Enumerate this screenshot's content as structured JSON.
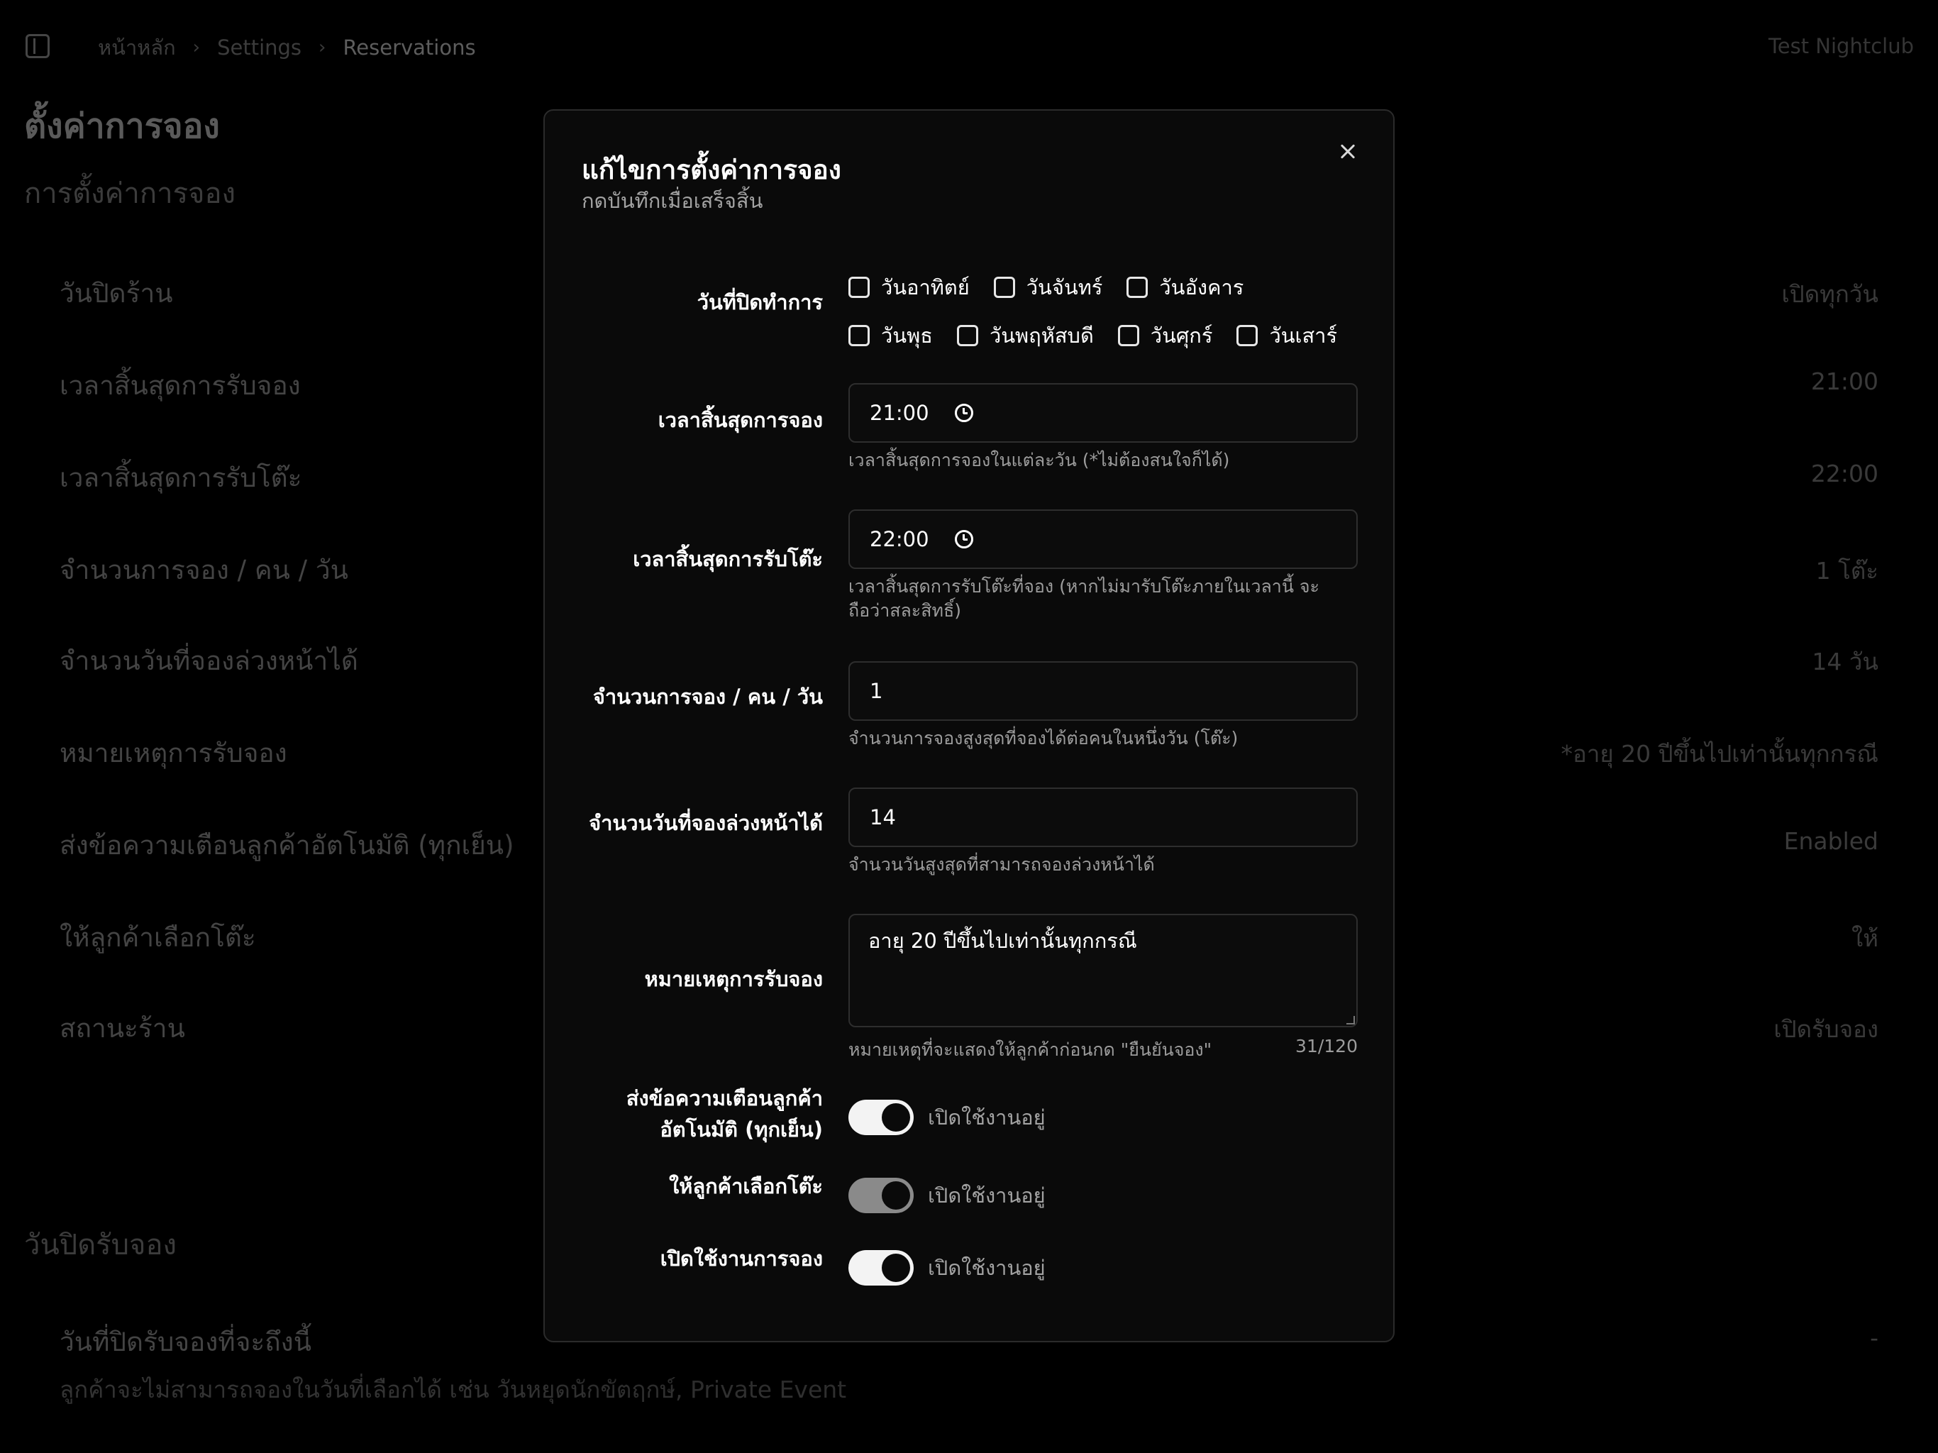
{
  "header": {
    "breadcrumb": [
      "หน้าหลัก",
      "Settings",
      "Reservations"
    ],
    "venue_name": "Test Nightclub"
  },
  "background": {
    "page_title": "ตั้งค่าการจอง",
    "section_title": "การตั้งค่าการจอง",
    "rows": [
      {
        "label": "วันปิดร้าน",
        "value": "เปิดทุกวัน"
      },
      {
        "label": "เวลาสิ้นสุดการรับจอง",
        "value": "21:00"
      },
      {
        "label": "เวลาสิ้นสุดการรับโต๊ะ",
        "value": "22:00"
      },
      {
        "label": "จำนวนการจอง / คน / วัน",
        "value": "1 โต๊ะ"
      },
      {
        "label": "จำนวนวันที่จองล่วงหน้าได้",
        "value": "14 วัน"
      },
      {
        "label": "หมายเหตุการรับจอง",
        "value": "*อายุ 20 ปีขึ้นไปเท่านั้นทุกกรณี"
      },
      {
        "label": "ส่งข้อความเตือนลูกค้าอัตโนมัติ (ทุกเย็น)",
        "value": "Enabled"
      },
      {
        "label": "ให้ลูกค้าเลือกโต๊ะ",
        "value": "ให้"
      },
      {
        "label": "สถานะร้าน",
        "value": "เปิดรับจอง"
      }
    ],
    "closure_section_title": "วันปิดรับจอง",
    "closure_row": {
      "label": "วันที่ปิดรับจองที่จะถึงนี้",
      "description": "ลูกค้าจะไม่สามารถจองในวันที่เลือกได้ เช่น วันหยุดนักขัตฤกษ์, Private Event",
      "value": "-"
    }
  },
  "modal": {
    "title": "แก้ไขการตั้งค่าการจอง",
    "subtitle": "กดบันทึกเมื่อเสร็จสิ้น",
    "closed_days": {
      "label": "วันที่ปิดทำการ",
      "days": [
        "วันอาทิตย์",
        "วันจันทร์",
        "วันอังคาร",
        "วันพุธ",
        "วันพฤหัสบดี",
        "วันศุกร์",
        "วันเสาร์"
      ]
    },
    "booking_end_time": {
      "label": "เวลาสิ้นสุดการจอง",
      "value": "21:00",
      "help": "เวลาสิ้นสุดการจองในแต่ละวัน (*ไม่ต้องสนใจก็ได้)"
    },
    "table_end_time": {
      "label": "เวลาสิ้นสุดการรับโต๊ะ",
      "value": "22:00",
      "help": "เวลาสิ้นสุดการรับโต๊ะที่จอง (หากไม่มารับโต๊ะภายในเวลานี้ จะถือว่าสละสิทธิ์)"
    },
    "bookings_per_day": {
      "label": "จำนวนการจอง / คน / วัน",
      "value": "1",
      "help": "จำนวนการจองสูงสุดที่จองได้ต่อคนในหนึ่งวัน (โต๊ะ)"
    },
    "advance_days": {
      "label": "จำนวนวันที่จองล่วงหน้าได้",
      "value": "14",
      "help": "จำนวนวันสูงสุดที่สามารถจองล่วงหน้าได้"
    },
    "booking_note": {
      "label": "หมายเหตุการรับจอง",
      "value": "อายุ 20 ปีขึ้นไปเท่านั้นทุกกรณี",
      "help": "หมายเหตุที่จะแสดงให้ลูกค้าก่อนกด \"ยืนยันจอง\"",
      "counter": "31/120"
    },
    "auto_reminder": {
      "label_line1": "ส่งข้อความเตือนลูกค้า",
      "label_line2": "อัตโนมัติ (ทุกเย็น)",
      "status": "เปิดใช้งานอยู่"
    },
    "table_selection": {
      "label": "ให้ลูกค้าเลือกโต๊ะ",
      "status": "เปิดใช้งานอยู่"
    },
    "enable_booking": {
      "label": "เปิดใช้งานการจอง",
      "status": "เปิดใช้งานอยู่"
    }
  },
  "icons": {
    "sidebar_toggle": "sidebar-panel-icon",
    "close": "close-x-icon",
    "clock": "clock-icon",
    "chevron": "chevron-right-icon"
  },
  "colors": {
    "background": "#000000",
    "modal_background": "#0a0a0a",
    "toggle_on": "#f3f3f3",
    "toggle_muted": "#8a8a8a"
  }
}
